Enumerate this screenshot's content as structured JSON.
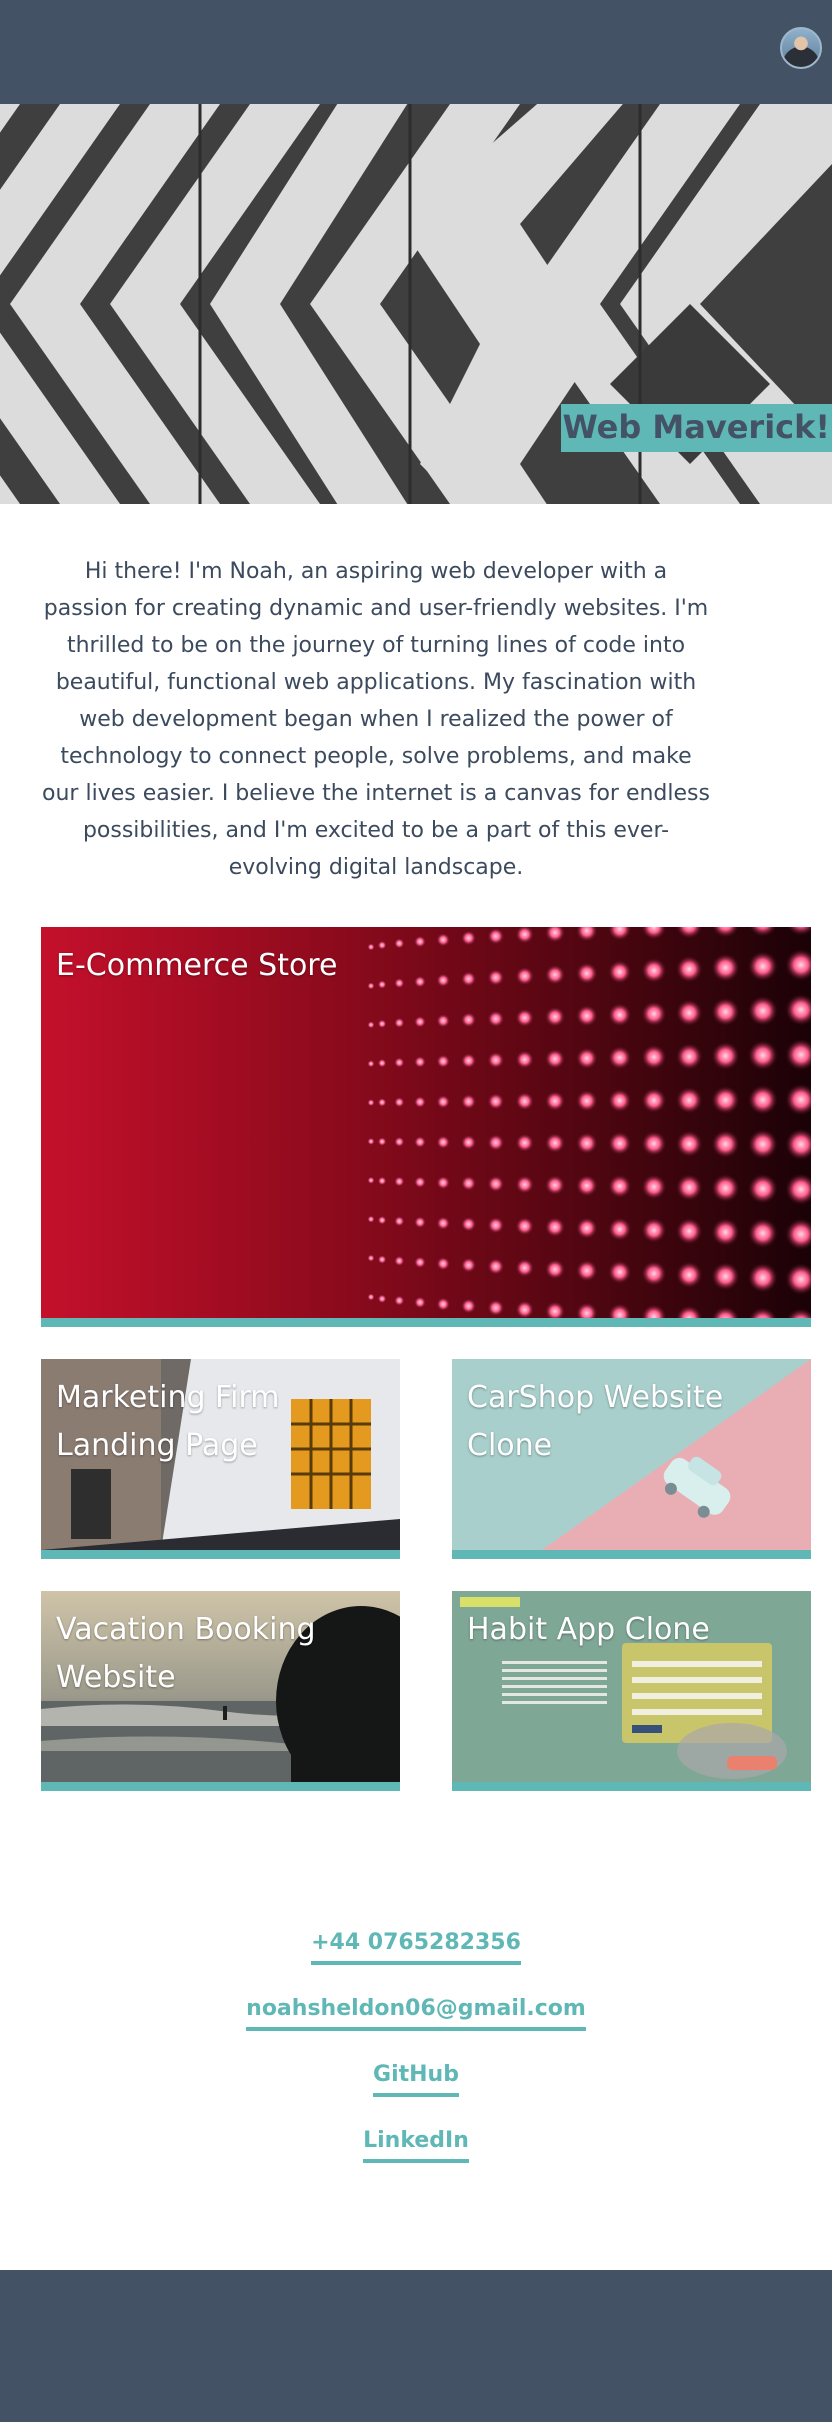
{
  "header": {
    "avatar_alt": "Noah avatar"
  },
  "hero": {
    "title": "Web Maverick!"
  },
  "intro": {
    "text": "Hi there! I'm Noah, an aspiring web developer with a passion for creating dynamic and user-friendly websites. I'm thrilled to be on the journey of turning lines of code into beautiful, functional web applications. My fascination with web development began when I realized the power of technology to connect people, solve problems, and make our lives easier. I believe the internet is a canvas for endless possibilities, and I'm excited to be a part of this ever-evolving digital landscape."
  },
  "projects": [
    {
      "title": "E-Commerce Store"
    },
    {
      "title": "Marketing Firm Landing Page"
    },
    {
      "title": "CarShop Website Clone"
    },
    {
      "title": "Vacation Booking Website"
    },
    {
      "title": "Habit App Clone"
    }
  ],
  "contact": {
    "phone": "+44 0765282356",
    "email": "noahsheldon06@gmail.com",
    "github": "GitHub",
    "linkedin": "LinkedIn"
  },
  "colors": {
    "header_bg": "#435265",
    "accent": "#5fb8b6",
    "text": "#3c4a5e"
  }
}
